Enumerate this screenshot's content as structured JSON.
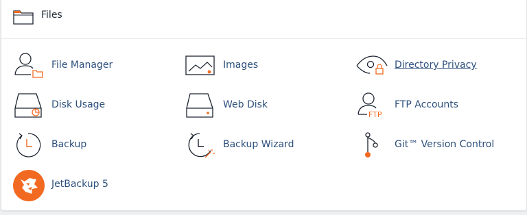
{
  "section": {
    "title": "Files",
    "icon": "folder-icon"
  },
  "colors": {
    "accent": "#f26a21",
    "link": "#2c4f7c",
    "icon_stroke": "#1c2430"
  },
  "items": [
    {
      "label": "File Manager",
      "icon": "file-manager-icon"
    },
    {
      "label": "Images",
      "icon": "image-icon"
    },
    {
      "label": "Directory Privacy",
      "icon": "eye-icon"
    },
    {
      "label": "Disk Usage",
      "icon": "disk-usage-icon"
    },
    {
      "label": "Web Disk",
      "icon": "web-disk-icon"
    },
    {
      "label": "FTP Accounts",
      "icon": "ftp-accounts-icon"
    },
    {
      "label": "Backup",
      "icon": "backup-icon"
    },
    {
      "label": "Backup Wizard",
      "icon": "backup-wizard-icon"
    },
    {
      "label": "Git™ Version Control",
      "icon": "git-icon"
    },
    {
      "label": "JetBackup 5",
      "icon": "jetbackup-icon"
    }
  ]
}
